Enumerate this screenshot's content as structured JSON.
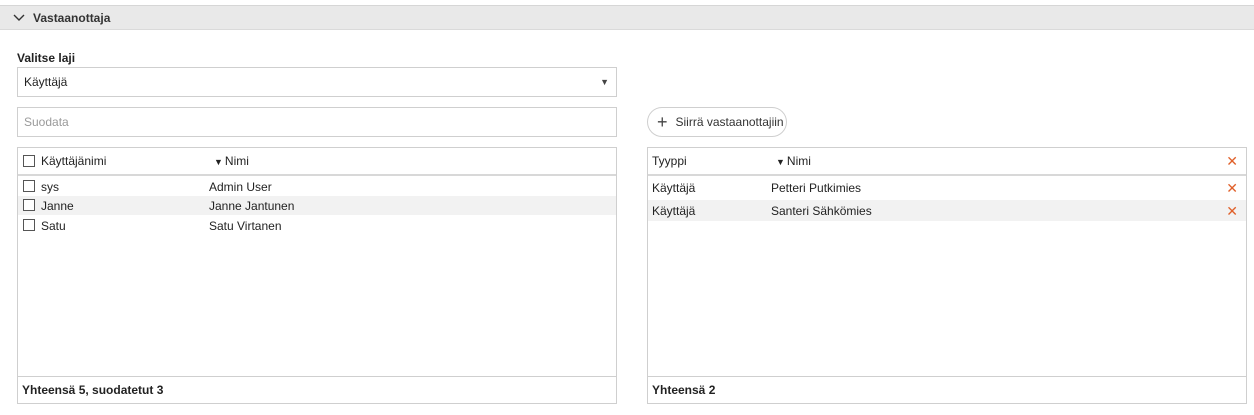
{
  "section": {
    "title": "Vastaanottaja",
    "icon": "chevron-down-icon"
  },
  "type_select": {
    "label": "Valitse laji",
    "value": "Käyttäjä"
  },
  "filter": {
    "placeholder": "Suodata",
    "value": ""
  },
  "move_button": {
    "label": "Siirrä vastaanottajiin",
    "icon": "plus-icon"
  },
  "left_table": {
    "headers": {
      "username": "Käyttäjänimi",
      "name": "Nimi"
    },
    "rows": [
      {
        "username": "sys",
        "name": "Admin User"
      },
      {
        "username": "Janne",
        "name": "Janne Jantunen"
      },
      {
        "username": "Satu",
        "name": "Satu Virtanen"
      }
    ],
    "footer": "Yhteensä 5, suodatetut 3"
  },
  "right_table": {
    "headers": {
      "type": "Tyyppi",
      "name": "Nimi"
    },
    "rows": [
      {
        "type": "Käyttäjä",
        "name": "Petteri Putkimies"
      },
      {
        "type": "Käyttäjä",
        "name": "Santeri Sähkömies"
      }
    ],
    "footer": "Yhteensä 2"
  },
  "colors": {
    "remove": "#e0602a",
    "header_bg": "#e9e9e9",
    "border": "#cfcfcf"
  }
}
